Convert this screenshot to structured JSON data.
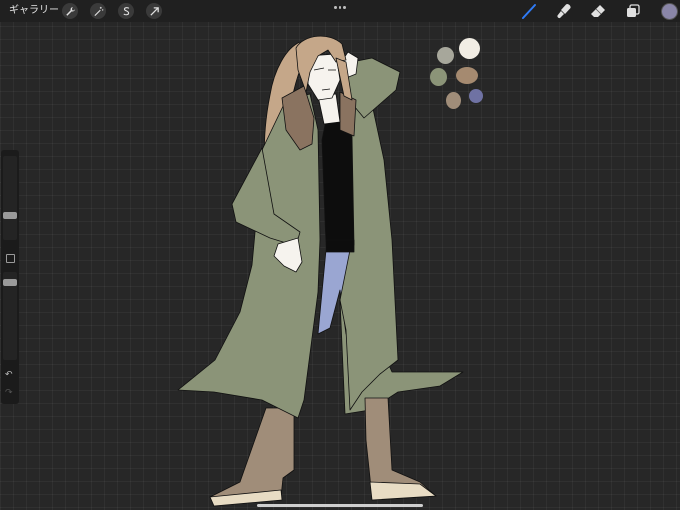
{
  "toolbar": {
    "gallery_label": "ギャラリー",
    "left_tools": [
      {
        "name": "wrench-icon"
      },
      {
        "name": "magic-wand-icon"
      },
      {
        "name": "selection-s-icon"
      },
      {
        "name": "transform-arrow-icon"
      }
    ],
    "right_tools": [
      {
        "name": "brush-icon",
        "active": true
      },
      {
        "name": "smudge-icon",
        "active": false
      },
      {
        "name": "eraser-icon",
        "active": false
      },
      {
        "name": "layers-icon",
        "active": false
      }
    ],
    "active_color": "#8a86a8",
    "active_tool_color": "#2f7bf6"
  },
  "sidebar": {
    "brush_size_thumb": "slider-thumb",
    "opacity_thumb": "slider-thumb",
    "undo_icon": "↶",
    "redo_icon": "↷"
  },
  "palette": {
    "colors": [
      "#a7a79b",
      "#f1ede4",
      "#8b9478",
      "#a58a70",
      "#a08d79",
      "#6f72a3"
    ]
  },
  "artwork": {
    "coat_color": "#8b9478",
    "hair_color": "#c5a789",
    "fur_color": "#8a7360",
    "shirt_color": "#0d0d0d",
    "jeans_color": "#9aa6d2",
    "boot_color": "#a08d79",
    "skin_color": "#f6f3ee"
  }
}
